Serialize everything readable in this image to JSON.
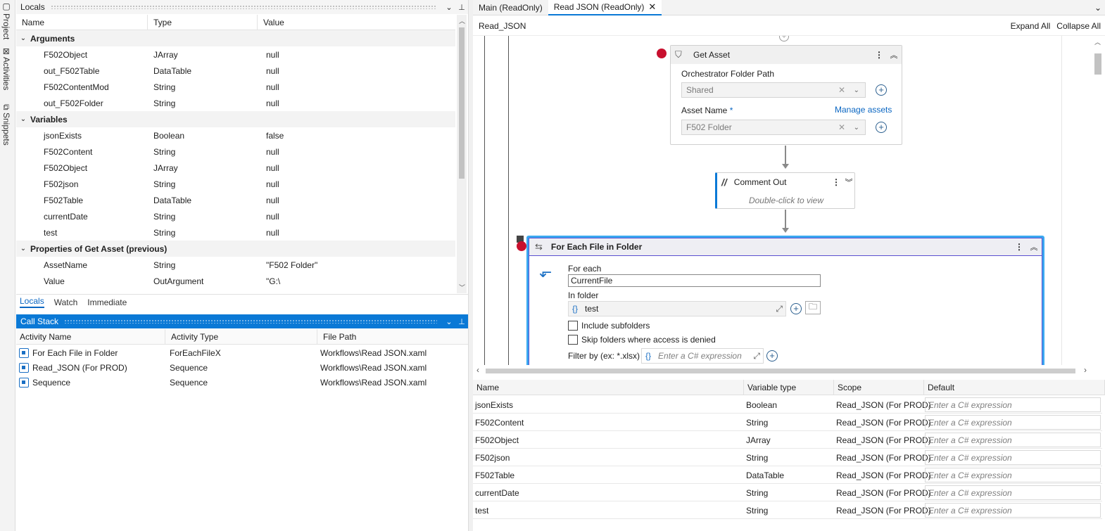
{
  "sidebar": {
    "tabs": [
      "Project",
      "Activities",
      "Snippets"
    ]
  },
  "locals": {
    "title": "Locals",
    "columns": [
      "Name",
      "Type",
      "Value"
    ],
    "groups": [
      {
        "label": "Arguments",
        "rows": [
          [
            "F502Object",
            "JArray",
            "null"
          ],
          [
            "out_F502Table",
            "DataTable",
            "null"
          ],
          [
            "F502ContentMod",
            "String",
            "null"
          ],
          [
            "out_F502Folder",
            "String",
            "null"
          ]
        ]
      },
      {
        "label": "Variables",
        "rows": [
          [
            "jsonExists",
            "Boolean",
            "false"
          ],
          [
            "F502Content",
            "String",
            "null"
          ],
          [
            "F502Object",
            "JArray",
            "null"
          ],
          [
            "F502json",
            "String",
            "null"
          ],
          [
            "F502Table",
            "DataTable",
            "null"
          ],
          [
            "currentDate",
            "String",
            "null"
          ],
          [
            "test",
            "String",
            "null"
          ]
        ]
      },
      {
        "label": "Properties of Get Asset (previous)",
        "rows": [
          [
            "AssetName",
            "String",
            "\"F502 Folder\""
          ],
          [
            "Value",
            "OutArgument",
            "\"G:\\"
          ]
        ]
      }
    ],
    "bottom_tabs": [
      "Locals",
      "Watch",
      "Immediate"
    ]
  },
  "callstack": {
    "title": "Call Stack",
    "columns": [
      "Activity Name",
      "Activity Type",
      "File Path"
    ],
    "rows": [
      [
        "For Each File in Folder",
        "ForEachFileX",
        "Workflows\\Read JSON.xaml"
      ],
      [
        "Read_JSON (For PROD)",
        "Sequence",
        "Workflows\\Read JSON.xaml"
      ],
      [
        "Sequence",
        "Sequence",
        "Workflows\\Read JSON.xaml"
      ]
    ]
  },
  "editor": {
    "tabs": [
      "Main (ReadOnly)",
      "Read JSON (ReadOnly)"
    ],
    "breadcrumb": "Read_JSON",
    "expand_all": "Expand All",
    "collapse_all": "Collapse All",
    "get_asset": {
      "title": "Get Asset",
      "folder_label": "Orchestrator Folder Path",
      "folder_value": "Shared",
      "asset_label": "Asset Name",
      "required_mark": "*",
      "manage_link": "Manage assets",
      "asset_value": "F502 Folder"
    },
    "comment_out": {
      "title": "Comment Out",
      "hint": "Double-click to view"
    },
    "foreach": {
      "title": "For Each File in Folder",
      "for_each_label": "For each",
      "for_each_value": "CurrentFile",
      "in_folder_label": "In folder",
      "in_folder_value": "test",
      "brace": "{}",
      "include_subfolders": "Include subfolders",
      "skip_denied": "Skip folders where access is denied",
      "filter_label": "Filter by (ex: *.xlsx)",
      "filter_placeholder": "Enter a C# expression"
    }
  },
  "variables": {
    "columns": [
      "Name",
      "Variable type",
      "Scope",
      "Default"
    ],
    "default_placeholder": "Enter a C# expression",
    "rows": [
      [
        "jsonExists",
        "Boolean",
        "Read_JSON (For PROD)"
      ],
      [
        "F502Content",
        "String",
        "Read_JSON (For PROD)"
      ],
      [
        "F502Object",
        "JArray",
        "Read_JSON (For PROD)"
      ],
      [
        "F502json",
        "String",
        "Read_JSON (For PROD)"
      ],
      [
        "F502Table",
        "DataTable",
        "Read_JSON (For PROD)"
      ],
      [
        "currentDate",
        "String",
        "Read_JSON (For PROD)"
      ],
      [
        "test",
        "String",
        "Read_JSON (For PROD)"
      ]
    ]
  },
  "colors": {
    "accent": "#0a79d6",
    "breakpoint": "#c8102e",
    "link": "#0a66c2"
  }
}
